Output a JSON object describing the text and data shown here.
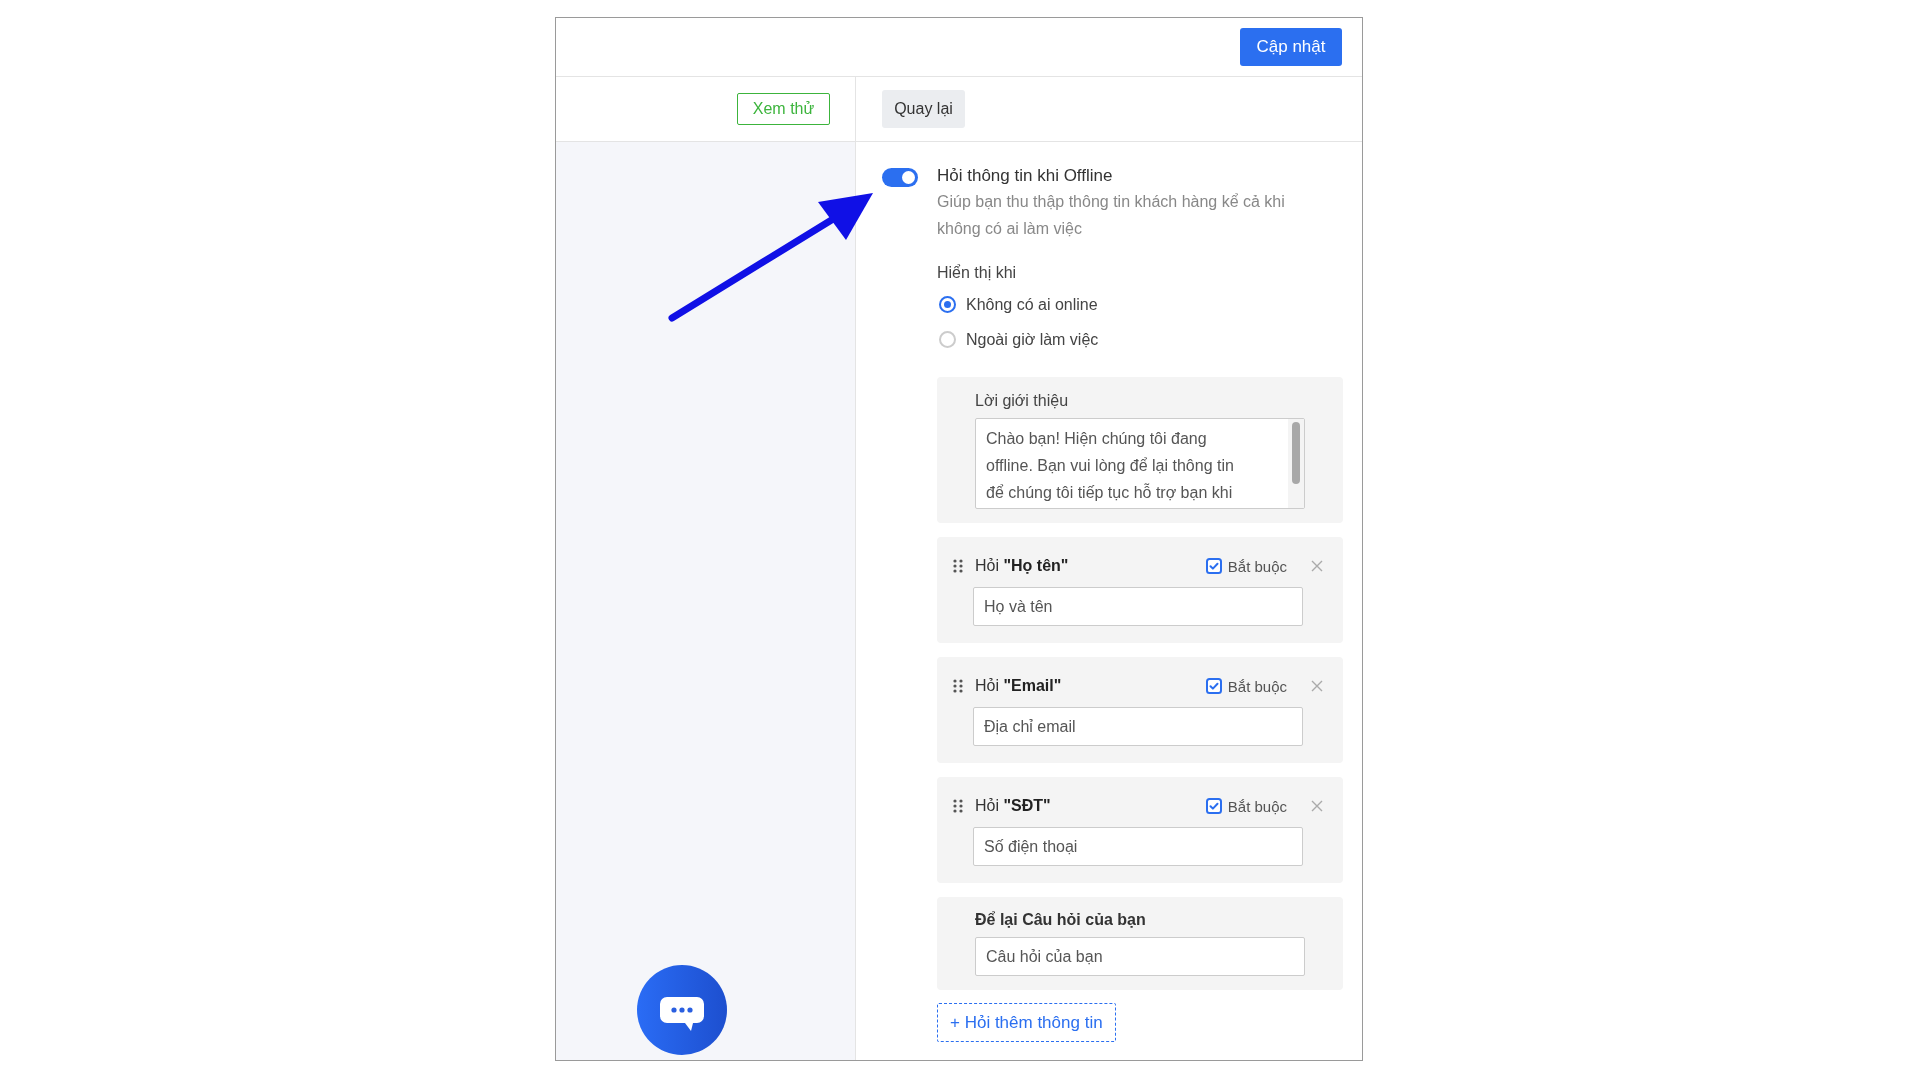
{
  "header": {
    "update_button": "Cập nhật"
  },
  "toolbar": {
    "preview_button": "Xem thử",
    "back_button": "Quay lại"
  },
  "offline_form": {
    "enabled": true,
    "title": "Hỏi thông tin khi Offline",
    "description": "Giúp bạn thu thập thông tin khách hàng kể cả khi không có ai làm việc",
    "show_when": {
      "label": "Hiển thị khi",
      "options": [
        {
          "label": "Không có ai online",
          "selected": true
        },
        {
          "label": "Ngoài giờ làm việc",
          "selected": false
        }
      ]
    },
    "intro": {
      "label": "Lời giới thiệu",
      "value": "Chào bạn! Hiện chúng tôi đang offline. Bạn vui lòng để lại thông tin để chúng tôi tiếp tục hỗ trợ bạn khi"
    },
    "questions": [
      {
        "title": "Hỏi **\"Họ tên\"**",
        "required_label": "Bắt buộc",
        "checked": true,
        "placeholder": "Họ và tên"
      },
      {
        "title": "Hỏi **\"Email\"**",
        "required_label": "Bắt buộc",
        "checked": true,
        "placeholder": "Địa chỉ email"
      },
      {
        "title": "Hỏi **\"SĐT\"**",
        "required_label": "Bắt buộc",
        "checked": true,
        "placeholder": "Số điện thoại"
      }
    ],
    "own_question": {
      "label": "Để lại Câu hỏi của bạn",
      "placeholder": "Câu hỏi của bạn"
    },
    "add_button": "+ Hỏi thêm thông tin"
  }
}
